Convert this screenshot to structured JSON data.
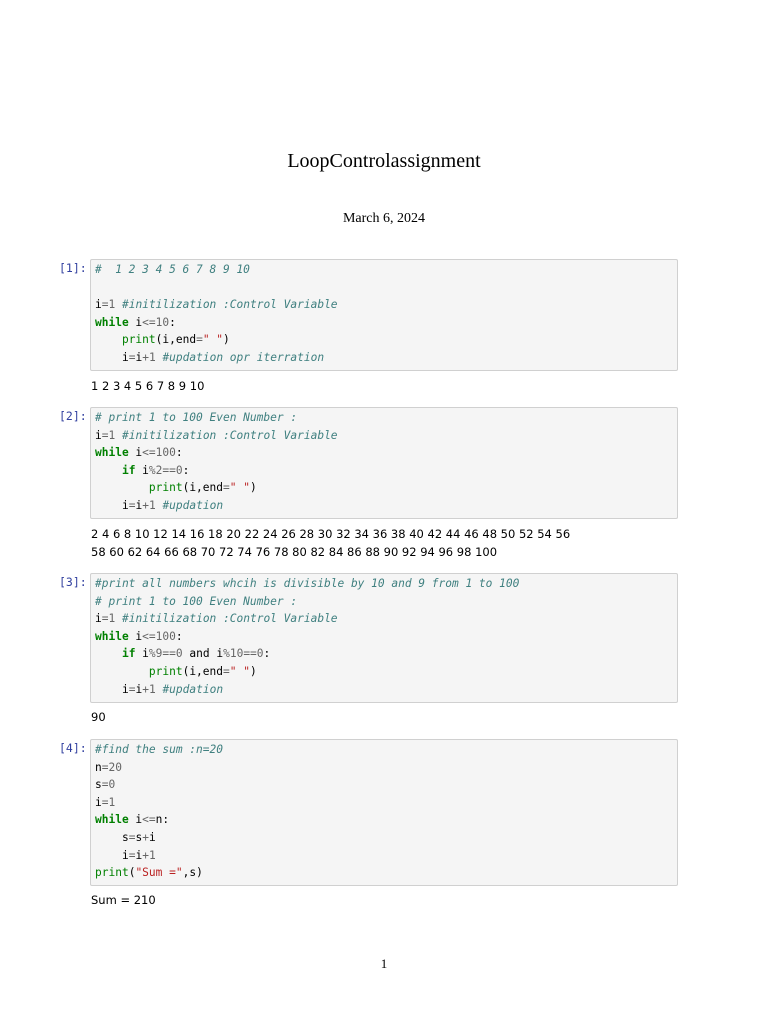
{
  "document": {
    "title": "LoopControlassignment",
    "date": "March 6, 2024",
    "page_number": "1"
  },
  "cells": [
    {
      "prompt": "[1]:",
      "code": [
        [
          [
            "c",
            "#  1 2 3 4 5 6 7 8 9 10"
          ]
        ],
        [],
        [
          [
            "",
            "i"
          ],
          [
            "o",
            "="
          ],
          [
            "m",
            "1"
          ],
          [
            "",
            " "
          ],
          [
            "c",
            "#initilization :Control Variable"
          ]
        ],
        [
          [
            "k",
            "while"
          ],
          [
            "",
            " i"
          ],
          [
            "o",
            "<="
          ],
          [
            "m",
            "10"
          ],
          [
            "",
            ":"
          ]
        ],
        [
          [
            "",
            "    "
          ],
          [
            "b",
            "print"
          ],
          [
            "",
            "(i,end"
          ],
          [
            "o",
            "="
          ],
          [
            "s",
            "\" \""
          ],
          [
            "",
            ")"
          ]
        ],
        [
          [
            "",
            "    i"
          ],
          [
            "o",
            "="
          ],
          [
            "",
            "i"
          ],
          [
            "o",
            "+"
          ],
          [
            "m",
            "1"
          ],
          [
            "",
            " "
          ],
          [
            "c",
            "#updation opr iterration"
          ]
        ]
      ],
      "output": [
        "1 2 3 4 5 6 7 8 9 10"
      ]
    },
    {
      "prompt": "[2]:",
      "code": [
        [
          [
            "c",
            "# print 1 to 100 Even Number :"
          ]
        ],
        [
          [
            "",
            "i"
          ],
          [
            "o",
            "="
          ],
          [
            "m",
            "1"
          ],
          [
            "",
            " "
          ],
          [
            "c",
            "#initilization :Control Variable"
          ]
        ],
        [
          [
            "k",
            "while"
          ],
          [
            "",
            " i"
          ],
          [
            "o",
            "<="
          ],
          [
            "m",
            "100"
          ],
          [
            "",
            ":"
          ]
        ],
        [
          [
            "",
            "    "
          ],
          [
            "k",
            "if"
          ],
          [
            "",
            " i"
          ],
          [
            "o",
            "%"
          ],
          [
            "m",
            "2"
          ],
          [
            "o",
            "=="
          ],
          [
            "m",
            "0"
          ],
          [
            "",
            ":"
          ]
        ],
        [
          [
            "",
            "        "
          ],
          [
            "b",
            "print"
          ],
          [
            "",
            "(i,end"
          ],
          [
            "o",
            "="
          ],
          [
            "s",
            "\" \""
          ],
          [
            "",
            ")"
          ]
        ],
        [
          [
            "",
            "    i"
          ],
          [
            "o",
            "="
          ],
          [
            "",
            "i"
          ],
          [
            "o",
            "+"
          ],
          [
            "m",
            "1"
          ],
          [
            "",
            " "
          ],
          [
            "c",
            "#updation"
          ]
        ]
      ],
      "output": [
        "2 4 6 8 10 12 14 16 18 20 22 24 26 28 30 32 34 36 38 40 42 44 46 48 50 52 54 56",
        "58 60 62 64 66 68 70 72 74 76 78 80 82 84 86 88 90 92 94 96 98 100"
      ]
    },
    {
      "prompt": "[3]:",
      "code": [
        [
          [
            "c",
            "#print all numbers whcih is divisible by 10 and 9 from 1 to 100"
          ]
        ],
        [
          [
            "c",
            "# print 1 to 100 Even Number :"
          ]
        ],
        [
          [
            "",
            "i"
          ],
          [
            "o",
            "="
          ],
          [
            "m",
            "1"
          ],
          [
            "",
            " "
          ],
          [
            "c",
            "#initilization :Control Variable"
          ]
        ],
        [
          [
            "k",
            "while"
          ],
          [
            "",
            " i"
          ],
          [
            "o",
            "<="
          ],
          [
            "m",
            "100"
          ],
          [
            "",
            ":"
          ]
        ],
        [
          [
            "",
            "    "
          ],
          [
            "k",
            "if"
          ],
          [
            "",
            " i"
          ],
          [
            "o",
            "%"
          ],
          [
            "m",
            "9"
          ],
          [
            "o",
            "=="
          ],
          [
            "m",
            "0"
          ],
          [
            "",
            " and i"
          ],
          [
            "o",
            "%"
          ],
          [
            "m",
            "10"
          ],
          [
            "o",
            "=="
          ],
          [
            "m",
            "0"
          ],
          [
            "",
            ":"
          ]
        ],
        [
          [
            "",
            "        "
          ],
          [
            "b",
            "print"
          ],
          [
            "",
            "(i,end"
          ],
          [
            "o",
            "="
          ],
          [
            "s",
            "\" \""
          ],
          [
            "",
            ")"
          ]
        ],
        [
          [
            "",
            "    i"
          ],
          [
            "o",
            "="
          ],
          [
            "",
            "i"
          ],
          [
            "o",
            "+"
          ],
          [
            "m",
            "1"
          ],
          [
            "",
            " "
          ],
          [
            "c",
            "#updation"
          ]
        ]
      ],
      "output": [
        "90"
      ]
    },
    {
      "prompt": "[4]:",
      "code": [
        [
          [
            "c",
            "#find the sum :n=20"
          ]
        ],
        [
          [
            "",
            "n"
          ],
          [
            "o",
            "="
          ],
          [
            "m",
            "20"
          ]
        ],
        [
          [
            "",
            "s"
          ],
          [
            "o",
            "="
          ],
          [
            "m",
            "0"
          ]
        ],
        [
          [
            "",
            "i"
          ],
          [
            "o",
            "="
          ],
          [
            "m",
            "1"
          ]
        ],
        [
          [
            "k",
            "while"
          ],
          [
            "",
            " i"
          ],
          [
            "o",
            "<="
          ],
          [
            "",
            "n:"
          ]
        ],
        [
          [
            "",
            "    s"
          ],
          [
            "o",
            "="
          ],
          [
            "",
            "s"
          ],
          [
            "o",
            "+"
          ],
          [
            "",
            "i"
          ]
        ],
        [
          [
            "",
            "    i"
          ],
          [
            "o",
            "="
          ],
          [
            "",
            "i"
          ],
          [
            "o",
            "+"
          ],
          [
            "m",
            "1"
          ]
        ],
        [
          [
            "b",
            "print"
          ],
          [
            "",
            "("
          ],
          [
            "s",
            "\"Sum =\""
          ],
          [
            "",
            ",s)"
          ]
        ]
      ],
      "output": [
        "Sum = 210"
      ]
    }
  ]
}
